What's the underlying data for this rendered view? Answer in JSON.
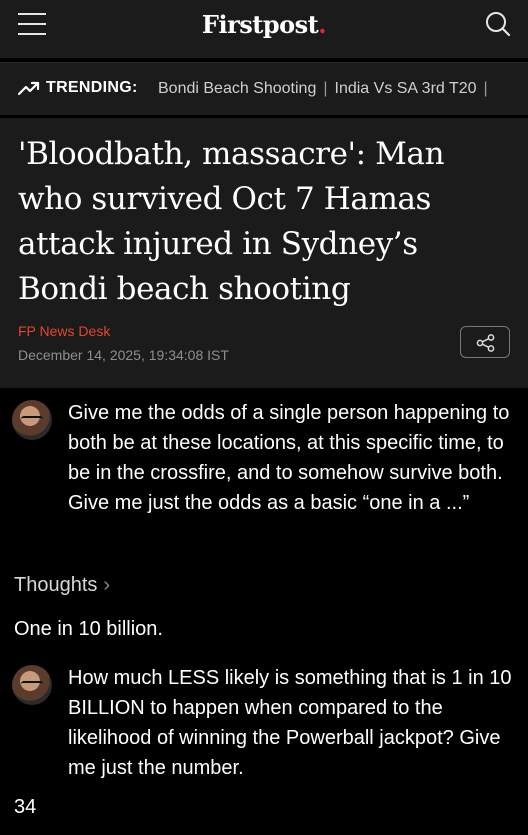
{
  "header": {
    "logo_text": "Firstpost",
    "logo_dot": "."
  },
  "trending": {
    "label": "TRENDING:",
    "items": [
      "Bondi Beach Shooting",
      "India Vs SA 3rd T20"
    ]
  },
  "article": {
    "headline": "'Bloodbath, massacre': Man who survived Oct 7 Hamas attack injured in Sydney’s Bondi beach shooting",
    "author": "FP News Desk",
    "date": "December 14, 2025, 19:34:08 IST"
  },
  "chat": {
    "prompt1": "Give me the odds of a single person happening to both be at these locations, at this specific time, to be in the crossfire, and to somehow survive both. Give me just the odds as a basic “one in a ...”",
    "thoughts_label": "Thoughts",
    "answer1": "One in 10 billion.",
    "prompt2": "How much LESS likely is something that is 1 in 10 BILLION to happen when compared to the likelihood of winning the Powerball jackpot?  Give me just the number.",
    "answer2": "34"
  },
  "colors": {
    "accent_red": "#e4252c",
    "author_red": "#e4452c",
    "panel_bg": "#1b1b1b"
  },
  "icons": [
    "menu-icon",
    "search-icon",
    "trending-icon",
    "share-icon",
    "chevron-right-icon"
  ]
}
